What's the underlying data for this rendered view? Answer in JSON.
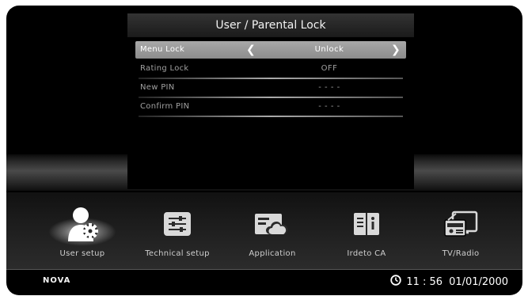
{
  "dialog": {
    "title": "User / Parental Lock",
    "rows": [
      {
        "label": "Menu Lock",
        "value": "Unlock"
      },
      {
        "label": "Rating Lock",
        "value": "OFF"
      },
      {
        "label": "New PIN",
        "value": "- - - -"
      },
      {
        "label": "Confirm PIN",
        "value": "- - - -"
      }
    ]
  },
  "menu": {
    "items": [
      {
        "label": "User setup",
        "icon": "user-gear-icon"
      },
      {
        "label": "Technical setup",
        "icon": "sliders-icon"
      },
      {
        "label": "Application",
        "icon": "cloud-app-icon"
      },
      {
        "label": "Irdeto CA",
        "icon": "book-info-icon"
      },
      {
        "label": "TV/Radio",
        "icon": "radio-tv-icon"
      }
    ]
  },
  "footer": {
    "brand": "NOVA",
    "time": "11 : 56",
    "date": "01/01/2000"
  }
}
